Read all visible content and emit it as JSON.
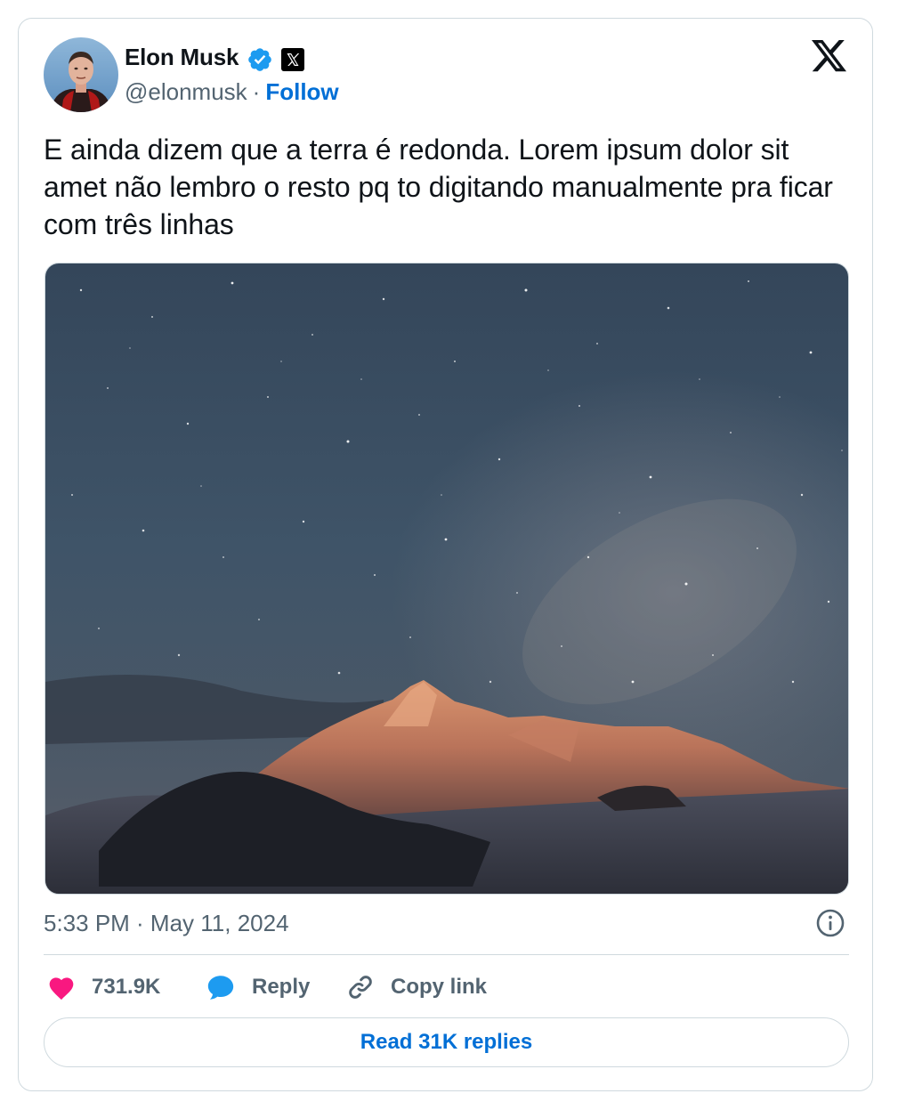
{
  "author": {
    "name": "Elon Musk",
    "handle": "@elonmusk",
    "separator": "·",
    "follow_label": "Follow"
  },
  "tweet": {
    "text": "E ainda dizem que a terra é redonda. Lorem ipsum dolor sit amet não lembro o resto pq to digitando manualmente pra ficar com três linhas",
    "timestamp": "5:33 PM · May 11, 2024"
  },
  "actions": {
    "likes_count": "731.9K",
    "reply_label": "Reply",
    "copy_link_label": "Copy link"
  },
  "read_replies_label": "Read 31K replies",
  "icons": {
    "verified": "verified-badge-icon",
    "affiliate": "x-affiliate-icon",
    "logo": "x-logo-icon",
    "info": "info-icon",
    "like": "heart-icon",
    "reply": "speech-bubble-icon",
    "copy": "link-icon"
  },
  "colors": {
    "link_blue": "#006fd6",
    "verified_blue": "#1d9bf0",
    "heart_pink": "#f91880",
    "text_primary": "#0f1419",
    "text_secondary": "#536471",
    "border": "#cfd9de"
  }
}
